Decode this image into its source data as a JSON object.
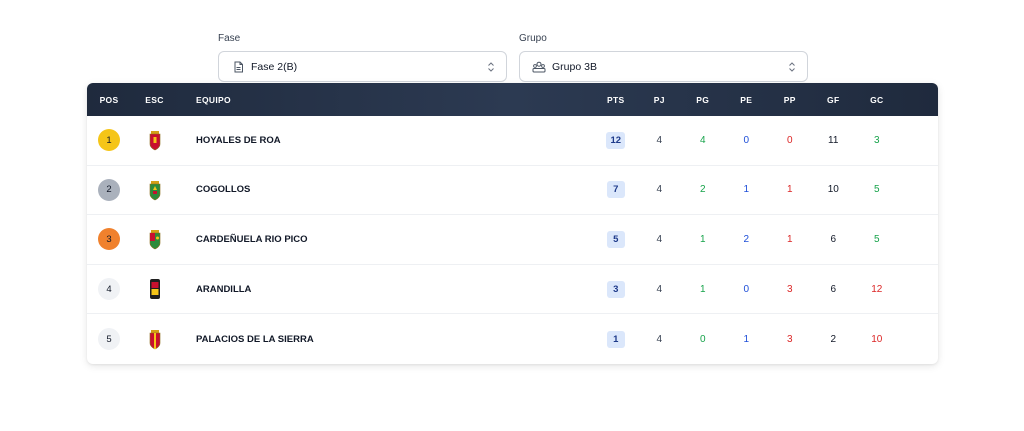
{
  "filters": {
    "fase": {
      "label": "Fase",
      "value": "Fase 2(B)",
      "icon": "document-icon"
    },
    "grupo": {
      "label": "Grupo",
      "value": "Grupo 3B",
      "icon": "group-icon"
    }
  },
  "table": {
    "headers": {
      "pos": "POS",
      "esc": "ESC",
      "team": "EQUIPO",
      "pts": "PTS",
      "pj": "PJ",
      "pg": "PG",
      "pe": "PE",
      "pp": "PP",
      "gf": "GF",
      "gc": "GC"
    },
    "rows": [
      {
        "pos": "1",
        "team": "HOYALES DE ROA",
        "pts": "12",
        "pj": "4",
        "pg": "4",
        "pe": "0",
        "pp": "0",
        "gf": "11",
        "gc": "3"
      },
      {
        "pos": "2",
        "team": "COGOLLOS",
        "pts": "7",
        "pj": "4",
        "pg": "2",
        "pe": "1",
        "pp": "1",
        "gf": "10",
        "gc": "5"
      },
      {
        "pos": "3",
        "team": "CARDEÑUELA RIO PICO",
        "pts": "5",
        "pj": "4",
        "pg": "1",
        "pe": "2",
        "pp": "1",
        "gf": "6",
        "gc": "5"
      },
      {
        "pos": "4",
        "team": "ARANDILLA",
        "pts": "3",
        "pj": "4",
        "pg": "1",
        "pe": "0",
        "pp": "3",
        "gf": "6",
        "gc": "12"
      },
      {
        "pos": "5",
        "team": "PALACIOS DE LA SIERRA",
        "pts": "1",
        "pj": "4",
        "pg": "0",
        "pe": "1",
        "pp": "3",
        "gf": "2",
        "gc": "10"
      }
    ]
  },
  "colors": {
    "header_bg": "#1f2a3d",
    "gold": "#f5c518",
    "silver": "#aab1bc",
    "bronze": "#f0812d",
    "neutral_badge": "#f0f2f5",
    "pts_badge": "#dbe7fb",
    "green": "#16a34a",
    "red": "#dc2626",
    "blue": "#1d4ed8"
  }
}
